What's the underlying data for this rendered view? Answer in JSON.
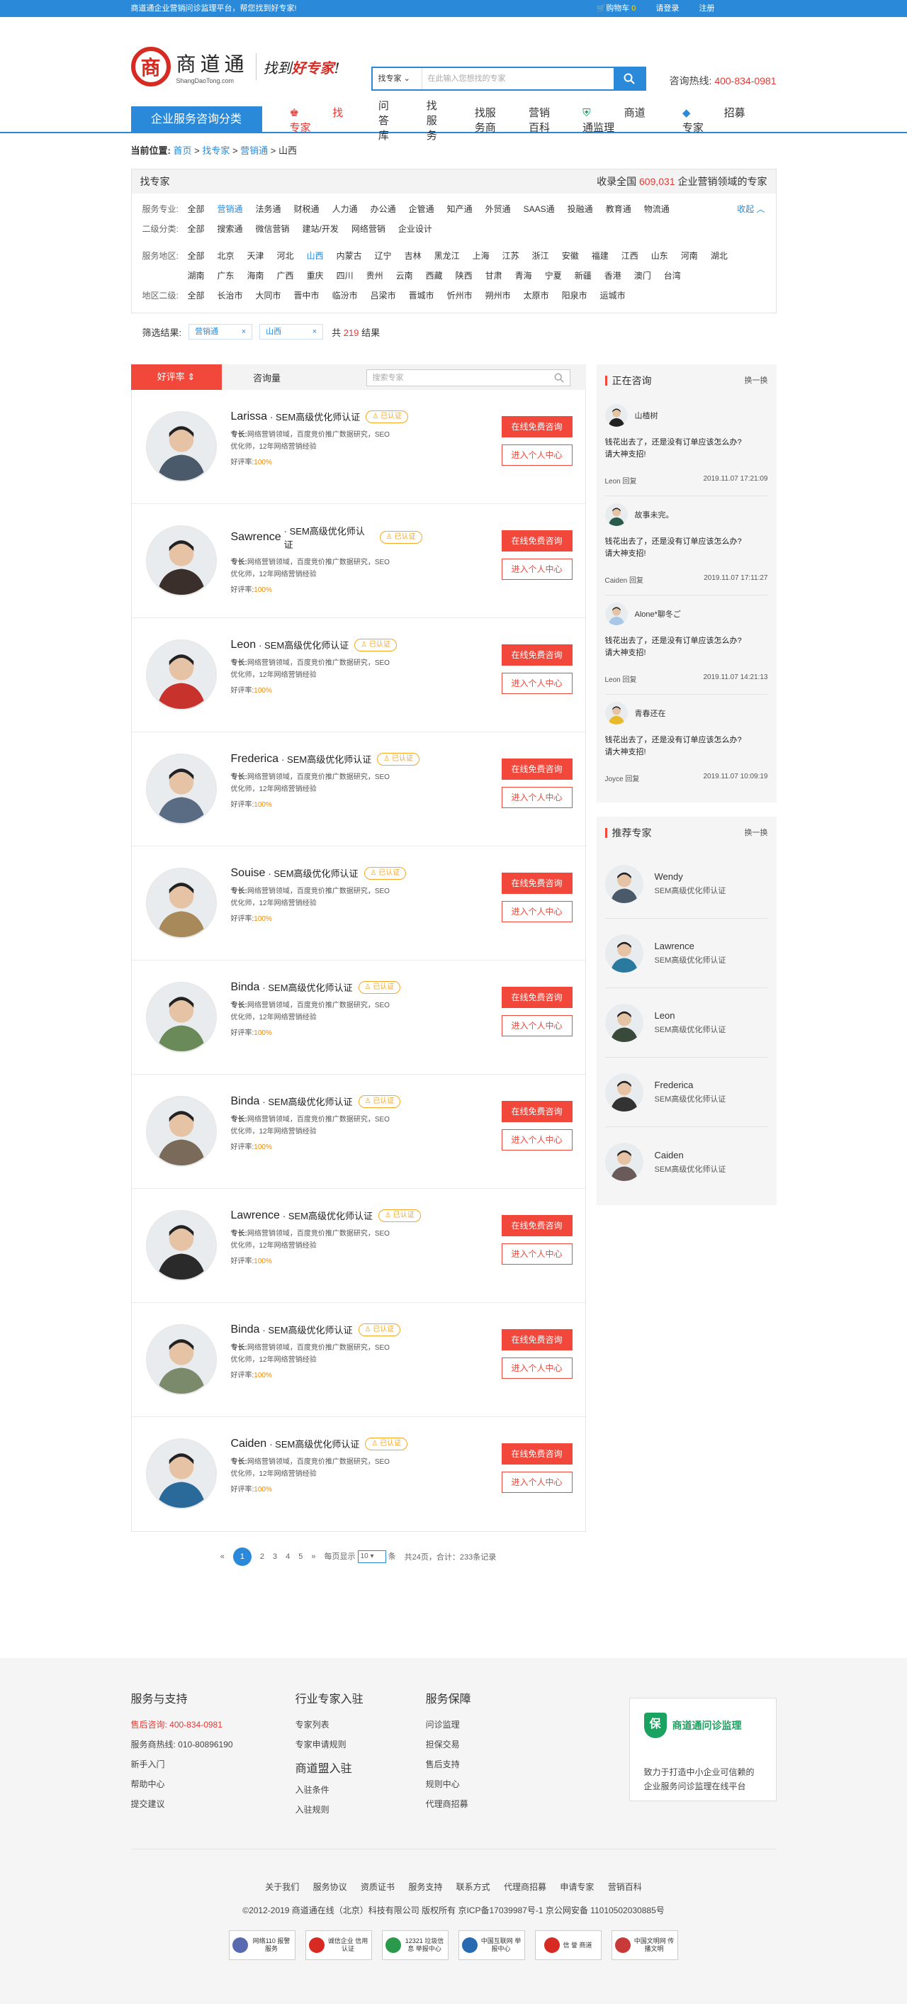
{
  "topbar": {
    "notice": "商道通企业营销问诊监理平台，帮您找到好专家!",
    "cart_label": "购物车",
    "cart_count": "0",
    "login": "请登录",
    "register": "注册"
  },
  "header": {
    "logo_char": "商",
    "logo_cn": "商道通",
    "logo_en": "ShangDaoTong.com",
    "slogan_a": "找到",
    "slogan_b": "好专家",
    "slogan_c": "!",
    "search_type": "找专家",
    "search_placeholder": "在此输入您想找的专家",
    "hotline_label": "咨询热线:",
    "hotline": "400-834-0981"
  },
  "nav": {
    "category": "企业服务咨询分类",
    "items": [
      "找专家",
      "问答库",
      "找服务",
      "找服务商",
      "营销百科",
      "商道通监理",
      "招募专家"
    ]
  },
  "breadcrumb": {
    "label": "当前位置:",
    "items": [
      "首页",
      "找专家",
      "营销通"
    ],
    "current": "山西"
  },
  "filter": {
    "title": "找专家",
    "stats_a": "收录全国",
    "stats_num": "609,031",
    "stats_b": "企业营销领域的专家",
    "rows": [
      {
        "key": "服务专业:",
        "values": [
          "全部",
          "营销通",
          "法务通",
          "财税通",
          "人力通",
          "办公通",
          "企管通",
          "知产通",
          "外贸通",
          "SAAS通",
          "投融通",
          "教育通",
          "物流通"
        ],
        "active": 1
      },
      {
        "key": "二级分类:",
        "values": [
          "全部",
          "搜索通",
          "微信营销",
          "建站/开发",
          "网络营销",
          "企业设计"
        ],
        "active": -1
      },
      {
        "key": "服务地区:",
        "values": [
          "全部",
          "北京",
          "天津",
          "河北",
          "山西",
          "内蒙古",
          "辽宁",
          "吉林",
          "黑龙江",
          "上海",
          "江苏",
          "浙江",
          "安徽",
          "福建",
          "江西",
          "山东",
          "河南",
          "湖北",
          "湖南",
          "广东",
          "海南",
          "广西",
          "重庆",
          "四川",
          "贵州",
          "云南",
          "西藏",
          "陕西",
          "甘肃",
          "青海",
          "宁夏",
          "新疆",
          "香港",
          "澳门",
          "台湾"
        ],
        "active": 4
      },
      {
        "key": "地区二级:",
        "values": [
          "全部",
          "长治市",
          "大同市",
          "晋中市",
          "临汾市",
          "吕梁市",
          "晋城市",
          "忻州市",
          "朔州市",
          "太原市",
          "阳泉市",
          "运城市"
        ],
        "active": -1
      }
    ],
    "collapse": "收起",
    "result_label": "筛选结果:",
    "tags": [
      "营销通",
      "山西"
    ],
    "count_a": "共",
    "count": "219",
    "count_b": "结果"
  },
  "tabs": {
    "t1": "好评率",
    "t2": "咨询量",
    "search_placeholder": "搜索专家"
  },
  "experts": [
    {
      "name": "Larissa",
      "cert": "· SEM高级优化师认证",
      "badge": "已认证",
      "label": "专长:",
      "desc_a": "网络营销领域，百度竞价推广数据研究，SEO",
      "desc_b": "优化师，12年网络营销经验",
      "rate_label": "好评率:",
      "rate": "100%",
      "btn1": "在线免费咨询",
      "btn2": "进入个人中心",
      "color": "#4a5a6a"
    },
    {
      "name": "Sawrence",
      "cert": "· SEM高级优化师认证",
      "badge": "已认证",
      "label": "专长:",
      "desc_a": "网络营销领域，百度竞价推广数据研究，SEO",
      "desc_b": "优化师，12年网络营销经验",
      "rate_label": "好评率:",
      "rate": "100%",
      "btn1": "在线免费咨询",
      "btn2": "进入个人中心",
      "color": "#3a2f2a"
    },
    {
      "name": "Leon",
      "cert": "· SEM高级优化师认证",
      "badge": "已认证",
      "label": "专长:",
      "desc_a": "网络营销领域，百度竞价推广数据研究，SEO",
      "desc_b": "优化师，12年网络营销经验",
      "rate_label": "好评率:",
      "rate": "100%",
      "btn1": "在线免费咨询",
      "btn2": "进入个人中心",
      "color": "#c8322c"
    },
    {
      "name": "Frederica",
      "cert": "· SEM高级优化师认证",
      "badge": "已认证",
      "label": "专长:",
      "desc_a": "网络营销领域，百度竞价推广数据研究，SEO",
      "desc_b": "优化师，12年网络营销经验",
      "rate_label": "好评率:",
      "rate": "100%",
      "btn1": "在线免费咨询",
      "btn2": "进入个人中心",
      "color": "#5a6c84"
    },
    {
      "name": "Souise",
      "cert": "· SEM高级优化师认证",
      "badge": "已认证",
      "label": "专长:",
      "desc_a": "网络营销领域，百度竞价推广数据研究，SEO",
      "desc_b": "优化师，12年网络营销经验",
      "rate_label": "好评率:",
      "rate": "100%",
      "btn1": "在线免费咨询",
      "btn2": "进入个人中心",
      "color": "#a8895a"
    },
    {
      "name": "Binda",
      "cert": "· SEM高级优化师认证",
      "badge": "已认证",
      "label": "专长:",
      "desc_a": "网络营销领域，百度竞价推广数据研究，SEO",
      "desc_b": "优化师，12年网络营销经验",
      "rate_label": "好评率:",
      "rate": "100%",
      "btn1": "在线免费咨询",
      "btn2": "进入个人中心",
      "color": "#6a8a5a"
    },
    {
      "name": "Binda",
      "cert": "· SEM高级优化师认证",
      "badge": "已认证",
      "label": "专长:",
      "desc_a": "网络营销领域，百度竞价推广数据研究，SEO",
      "desc_b": "优化师，12年网络营销经验",
      "rate_label": "好评率:",
      "rate": "100%",
      "btn1": "在线免费咨询",
      "btn2": "进入个人中心",
      "color": "#7a6a5a"
    },
    {
      "name": "Lawrence",
      "cert": "· SEM高级优化师认证",
      "badge": "已认证",
      "label": "专长:",
      "desc_a": "网络营销领域，百度竞价推广数据研究，SEO",
      "desc_b": "优化师，12年网络营销经验",
      "rate_label": "好评率:",
      "rate": "100%",
      "btn1": "在线免费咨询",
      "btn2": "进入个人中心",
      "color": "#2a2a2a"
    },
    {
      "name": "Binda",
      "cert": "· SEM高级优化师认证",
      "badge": "已认证",
      "label": "专长:",
      "desc_a": "网络营销领域，百度竞价推广数据研究，SEO",
      "desc_b": "优化师，12年网络营销经验",
      "rate_label": "好评率:",
      "rate": "100%",
      "btn1": "在线免费咨询",
      "btn2": "进入个人中心",
      "color": "#7a8a6a"
    },
    {
      "name": "Caiden",
      "cert": "· SEM高级优化师认证",
      "badge": "已认证",
      "label": "专长:",
      "desc_a": "网络营销领域，百度竞价推广数据研究，SEO",
      "desc_b": "优化师，12年网络营销经验",
      "rate_label": "好评率:",
      "rate": "100%",
      "btn1": "在线免费咨询",
      "btn2": "进入个人中心",
      "color": "#2a6a9a"
    }
  ],
  "pager": {
    "prev": "«",
    "pages": [
      "1",
      "2",
      "3",
      "4",
      "5"
    ],
    "next": "»",
    "per_label": "每页显示",
    "per": "10",
    "per_unit": "条",
    "total": "共24页，合计：233条记录"
  },
  "consult": {
    "title": "正在咨询",
    "switch": "换一换",
    "items": [
      {
        "user": "山楂树",
        "q1": "钱花出去了，还是没有订单应该怎么办?",
        "q2": "请大神支招!",
        "reply": "Leon 回复",
        "time": "2019.11.07   17:21:09",
        "color": "#222"
      },
      {
        "user": "故事未完。",
        "q1": "钱花出去了，还是没有订单应该怎么办?",
        "q2": "请大神支招!",
        "reply": "Caiden 回复",
        "time": "2019.11.07   17:11:27",
        "color": "#2a5a4a"
      },
      {
        "user": "Alone*聊冬ご",
        "q1": "钱花出去了，还是没有订单应该怎么办?",
        "q2": "请大神支招!",
        "reply": "Leon 回复",
        "time": "2019.11.07   14:21:13",
        "color": "#a9c8e8"
      },
      {
        "user": "青春还在",
        "q1": "钱花出去了，还是没有订单应该怎么办?",
        "q2": "请大神支招!",
        "reply": "Joyce 回复",
        "time": "2019.11.07   10:09:19",
        "color": "#e8b92a"
      }
    ]
  },
  "recommend": {
    "title": "推荐专家",
    "switch": "换一换",
    "items": [
      {
        "name": "Wendy",
        "title": "SEM高级优化师认证",
        "color": "#4a5a6a"
      },
      {
        "name": "Lawrence",
        "title": "SEM高级优化师认证",
        "color": "#2a7aa0"
      },
      {
        "name": "Leon",
        "title": "SEM高级优化师认证",
        "color": "#3a4a3a"
      },
      {
        "name": "Frederica",
        "title": "SEM高级优化师认证",
        "color": "#333"
      },
      {
        "name": "Caiden",
        "title": "SEM高级优化师认证",
        "color": "#6a5a5a"
      }
    ]
  },
  "footer": {
    "col1": {
      "title": "服务与支持",
      "hotline": "售后咨询: 400-834-0981",
      "items": [
        "服务商热线: 010-80896190",
        "新手入门",
        "帮助中心",
        "提交建议"
      ]
    },
    "col2": {
      "title": "行业专家入驻",
      "items": [
        "专家列表",
        "专家申请规则"
      ],
      "title2": "商道盟入驻",
      "items2": [
        "入驻条件",
        "入驻规则"
      ]
    },
    "col3": {
      "title": "服务保障",
      "items": [
        "问诊监理",
        "担保交易",
        "售后支持",
        "规则中心",
        "代理商招募"
      ]
    },
    "box": {
      "title": "商道通问诊监理",
      "icon": "保",
      "desc": "致力于打造中小企业可信赖的企业服务问诊监理在线平台"
    },
    "links": [
      "关于我们",
      "服务协议",
      "资质证书",
      "服务支持",
      "联系方式",
      "代理商招募",
      "申请专家",
      "营销百科"
    ],
    "copyright": "©2012-2019 商道通在线（北京）科技有限公司 版权所有 京ICP备17039987号-1     京公网安备 11010502030885号",
    "seals": [
      {
        "text": "网络110 报警服务",
        "color": "#5a6ab0"
      },
      {
        "text": "诚信企业 信用认证",
        "color": "#d62a23"
      },
      {
        "text": "12321 垃圾信息 举报中心",
        "color": "#2a9a4a"
      },
      {
        "text": "中国互联网 举报中心",
        "color": "#2a6ab0"
      },
      {
        "text": "信 誉 商道",
        "color": "#d62a23"
      },
      {
        "text": "中国文明网 传播文明",
        "color": "#c83a3a"
      }
    ]
  },
  "colors": {
    "accent": "#2a8ad9",
    "red": "#f2473b"
  }
}
